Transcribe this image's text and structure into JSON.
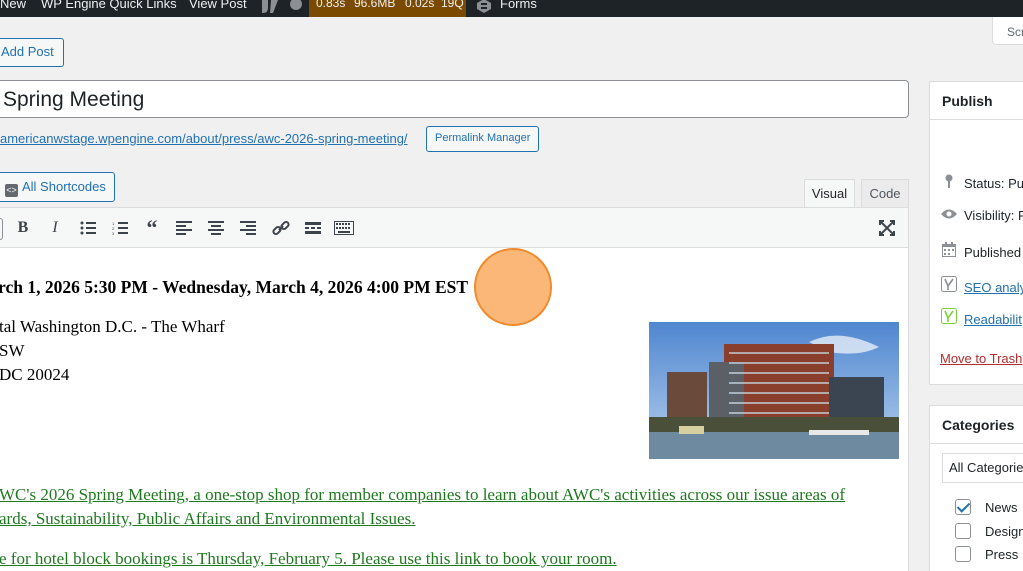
{
  "adminbar": {
    "new": "New",
    "quick_links": "WP Engine Quick Links",
    "view_post": "View Post",
    "metrics": [
      "0.83s",
      "96.6MB",
      "0.02s",
      "19Q"
    ],
    "forms": "Forms"
  },
  "screen_options": "Scr",
  "add_post": "Add Post",
  "post_title": "Spring Meeting",
  "permalink": {
    "url": "americanwstage.wpengine.com/about/press/awc-2026-spring-meeting/",
    "manager_label": "Permalink Manager"
  },
  "shortcodes_label": "All Shortcodes",
  "tabs": {
    "visual": "Visual",
    "code": "Code"
  },
  "content": {
    "date_line": "rch 1, 2026 5:30 PM - Wednesday, March 4, 2026 4:00 PM EST",
    "address": [
      "tal Washington D.C. - The Wharf",
      "SW",
      "DC 20024"
    ],
    "para1_line1": "WC's 2026 Spring Meeting, a one-stop shop for member companies to learn about AWC's activities across our issue areas of",
    "para1_line2": "ards, Sustainability, Public Affairs and Environmental Issues.",
    "para2": "e for hotel block bookings is Thursday, February 5. Please use this link to book your room."
  },
  "publish": {
    "title": "Publish",
    "status": "Status: Pu",
    "visibility": "Visibility: P",
    "published": "Published",
    "seo": "SEO analy",
    "readability": "Readabilit",
    "trash": "Move to Trash"
  },
  "categories": {
    "title": "Categories",
    "tab": "All Categorie",
    "items": [
      {
        "label": "News",
        "checked": true
      },
      {
        "label": "Design I",
        "checked": false
      },
      {
        "label": "Press",
        "checked": false
      }
    ]
  },
  "colors": {
    "adminbar": "#1d2327",
    "accent": "#2271b1",
    "content_link": "#1e7a1e",
    "cursor": "#f08a2a"
  }
}
